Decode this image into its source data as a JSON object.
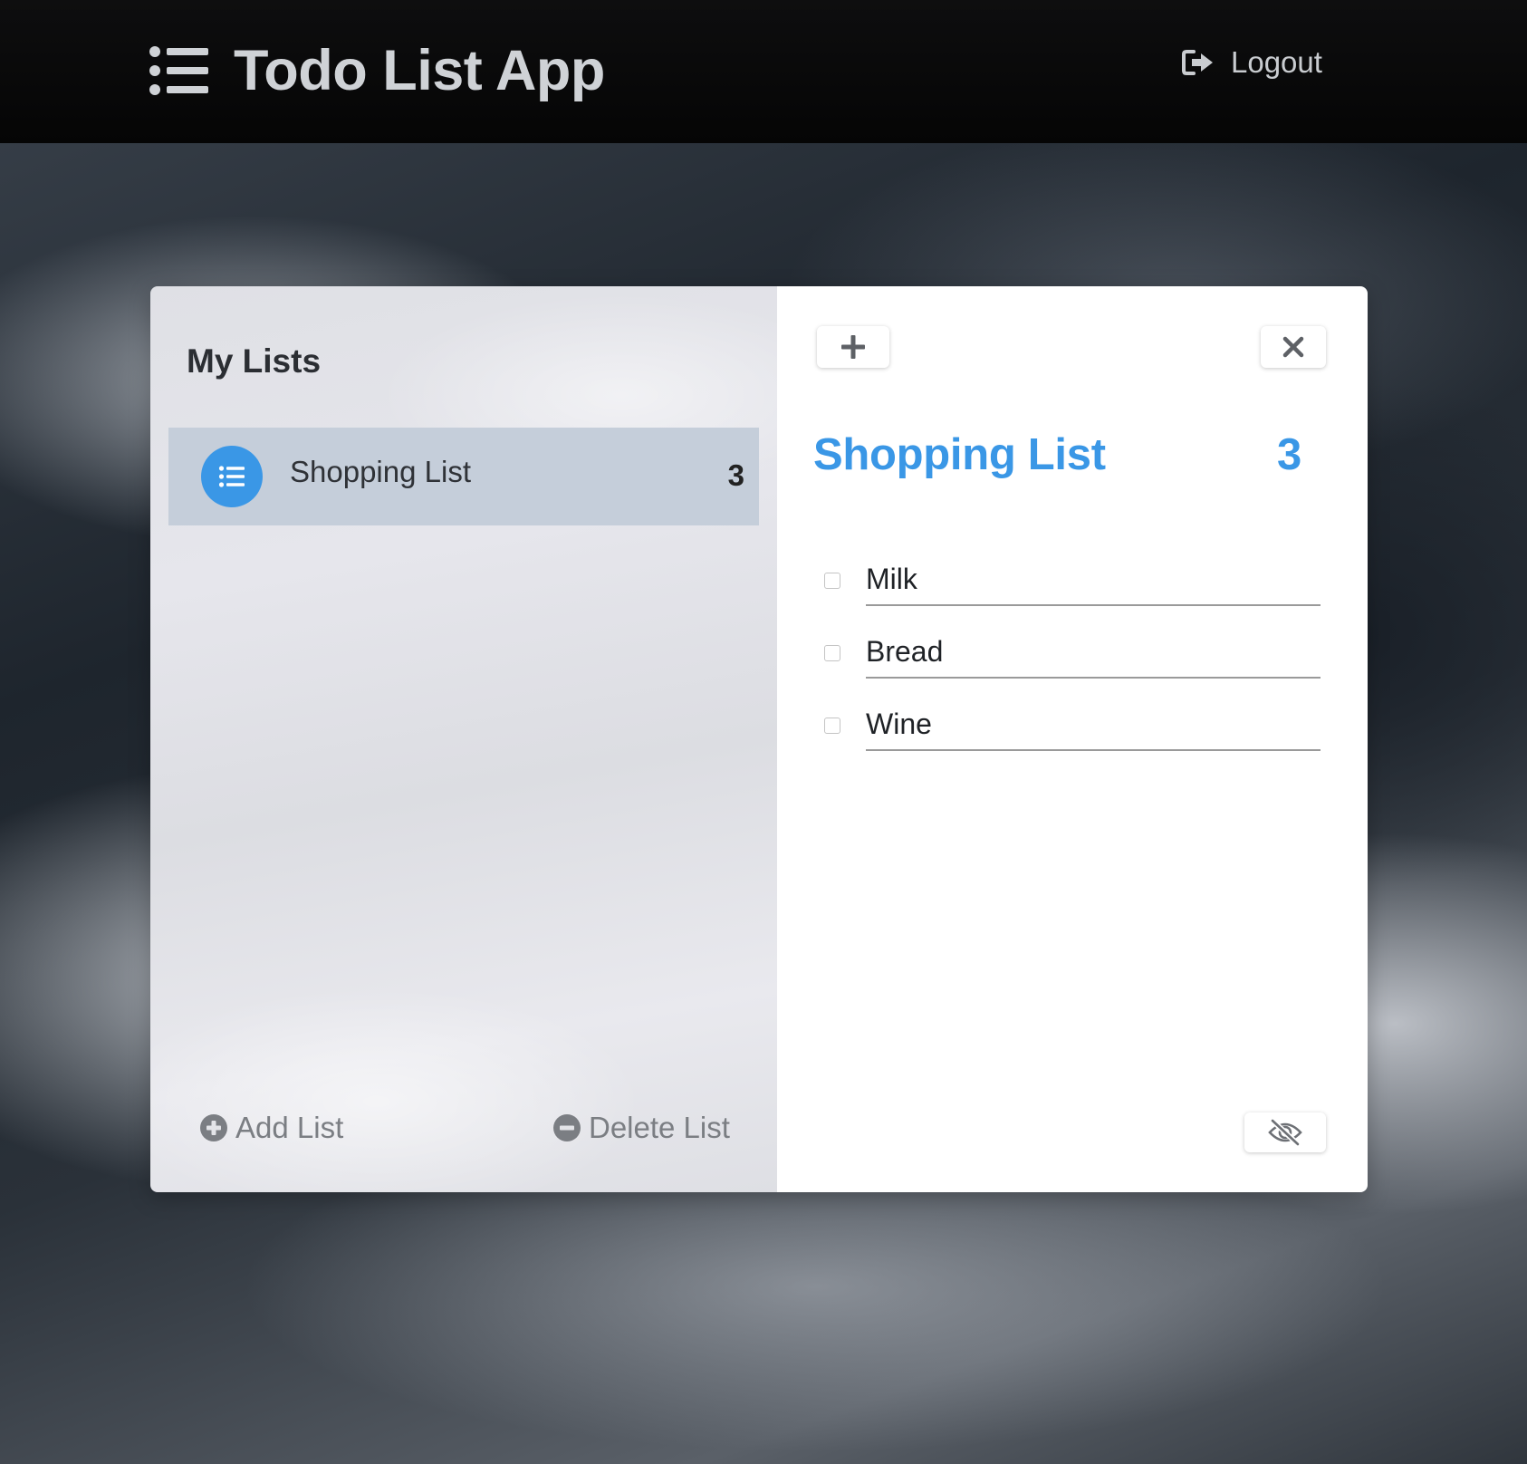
{
  "app": {
    "title": "Todo List App"
  },
  "header": {
    "logout_label": "Logout"
  },
  "sidebar": {
    "heading": "My Lists",
    "lists": [
      {
        "name": "Shopping List",
        "count": "3",
        "selected": true
      }
    ],
    "add_list_label": "Add List",
    "delete_list_label": "Delete List"
  },
  "detail": {
    "title": "Shopping List",
    "count": "3",
    "tasks": [
      {
        "text": "Milk",
        "done": false
      },
      {
        "text": "Bread",
        "done": false
      },
      {
        "text": "Wine",
        "done": false
      }
    ]
  },
  "icons": {
    "brand": "list-icon",
    "logout": "sign-out-icon",
    "list_avatar": "list-icon",
    "add_list": "plus-circle-icon",
    "delete_list": "minus-circle-icon",
    "add_task": "plus-icon",
    "close": "close-icon",
    "hide_completed": "eye-slash-icon"
  },
  "colors": {
    "accent": "#3a97e6",
    "header_bg": "#0a0a0a",
    "selected_list_bg": "#c5ceda"
  }
}
